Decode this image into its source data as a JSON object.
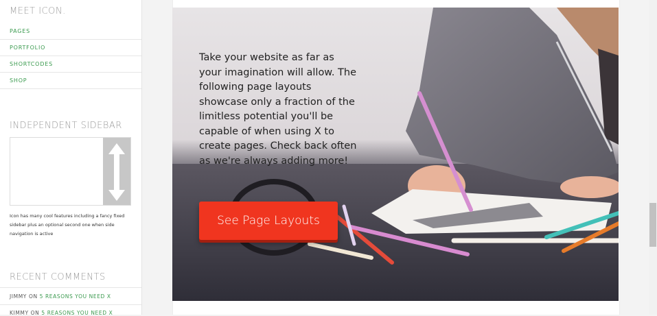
{
  "sidebar": {
    "meet_title": "MEET ICON.",
    "menu": [
      "PAGES",
      "PORTFOLIO",
      "SHORTCODES",
      "SHOP"
    ],
    "independent_title": "INDEPENDENT SIDEBAR",
    "ad_text": "Icon has many cool features including a fancy fixed sidebar plus an optional second one when side navigation is active",
    "recent_comments_title": "RECENT COMMENTS",
    "comments": [
      {
        "author": "JIMMY",
        "on": "ON",
        "post": "5 REASONS YOU NEED X"
      },
      {
        "author": "KIMMY",
        "on": "ON",
        "post": "5 REASONS YOU NEED X"
      }
    ]
  },
  "hero": {
    "text": "Take your website as far as your imagination will allow. The following page layouts showcase only a fraction of the limitless potential you'll be capable of when using X to create pages. Check back often as we're always adding more!",
    "button_label": "See Page Layouts"
  },
  "colors": {
    "accent_green": "#3a9a4e",
    "button_red": "#f0351f"
  }
}
